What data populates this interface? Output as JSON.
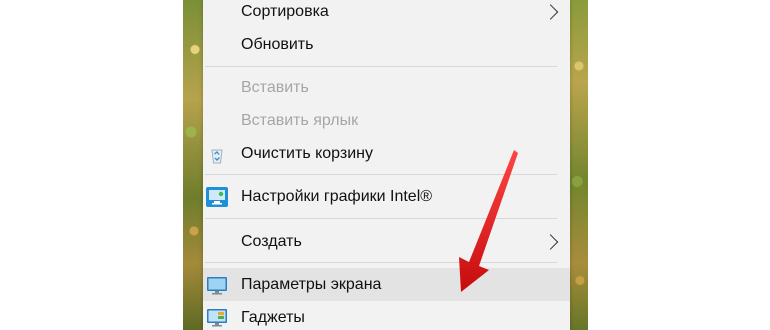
{
  "menu": {
    "items": [
      {
        "label": "Сортировка",
        "enabled": true,
        "submenu": true
      },
      {
        "label": "Обновить",
        "enabled": true
      },
      {
        "label": "Вставить",
        "enabled": false
      },
      {
        "label": "Вставить ярлык",
        "enabled": false
      },
      {
        "label": "Очистить корзину",
        "enabled": true,
        "icon": "recycle-bin-icon"
      },
      {
        "label": "Настройки графики Intel®",
        "enabled": true,
        "icon": "intel-graphics-icon"
      },
      {
        "label": "Создать",
        "enabled": true,
        "submenu": true
      },
      {
        "label": "Параметры экрана",
        "enabled": true,
        "icon": "display-settings-icon",
        "highlighted": true
      },
      {
        "label": "Гаджеты",
        "enabled": true,
        "icon": "gadgets-icon"
      }
    ]
  },
  "annotation": {
    "arrow_color": "#e8141b",
    "icon": "red-arrow-icon"
  },
  "colors": {
    "menu_bg": "#f2f2f2",
    "hover_bg": "#e3e3e3",
    "disabled_text": "#a6a6a6",
    "text": "#111111"
  }
}
